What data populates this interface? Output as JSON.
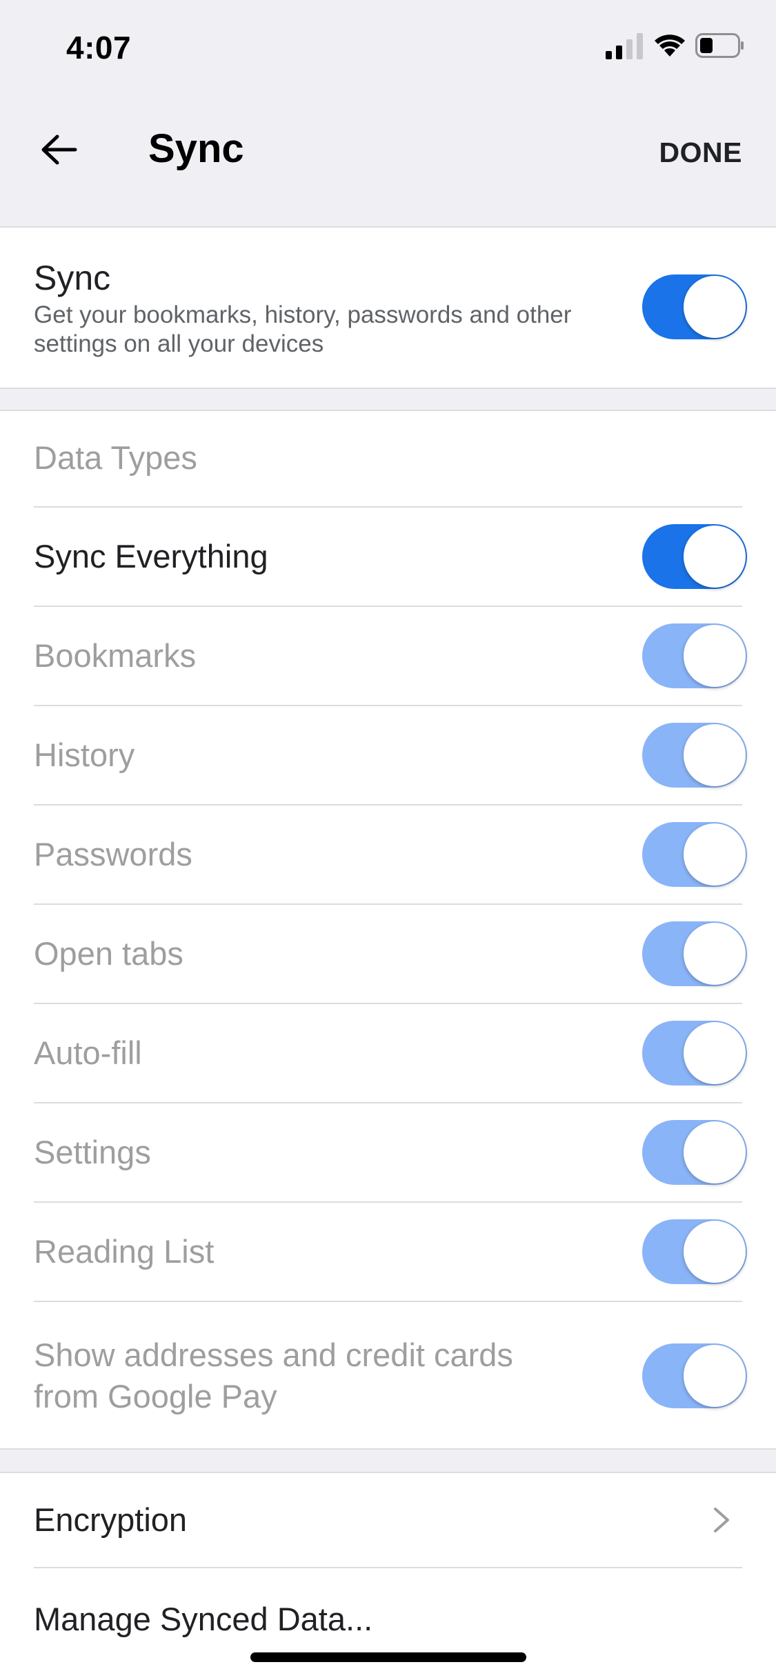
{
  "status_bar": {
    "time": "4:07"
  },
  "navbar": {
    "title": "Sync",
    "done_label": "DONE"
  },
  "sync_card": {
    "title": "Sync",
    "subtitle": "Get your bookmarks, history, passwords and other settings on all your devices",
    "enabled": true
  },
  "data_types": {
    "header": "Data Types",
    "sync_everything": {
      "label": "Sync Everything",
      "enabled": true
    },
    "items": [
      {
        "label": "Bookmarks",
        "enabled": true
      },
      {
        "label": "History",
        "enabled": true
      },
      {
        "label": "Passwords",
        "enabled": true
      },
      {
        "label": "Open tabs",
        "enabled": true
      },
      {
        "label": "Auto-fill",
        "enabled": true
      },
      {
        "label": "Settings",
        "enabled": true
      },
      {
        "label": "Reading List",
        "enabled": true
      },
      {
        "label": "Show addresses and credit cards from Google Pay",
        "enabled": true
      }
    ]
  },
  "bottom": {
    "encryption_label": "Encryption",
    "manage_label": "Manage Synced Data..."
  },
  "colors": {
    "toggle_on": "#1a73e8",
    "toggle_disabled": "#8ab4f8",
    "background": "#efeff4"
  }
}
